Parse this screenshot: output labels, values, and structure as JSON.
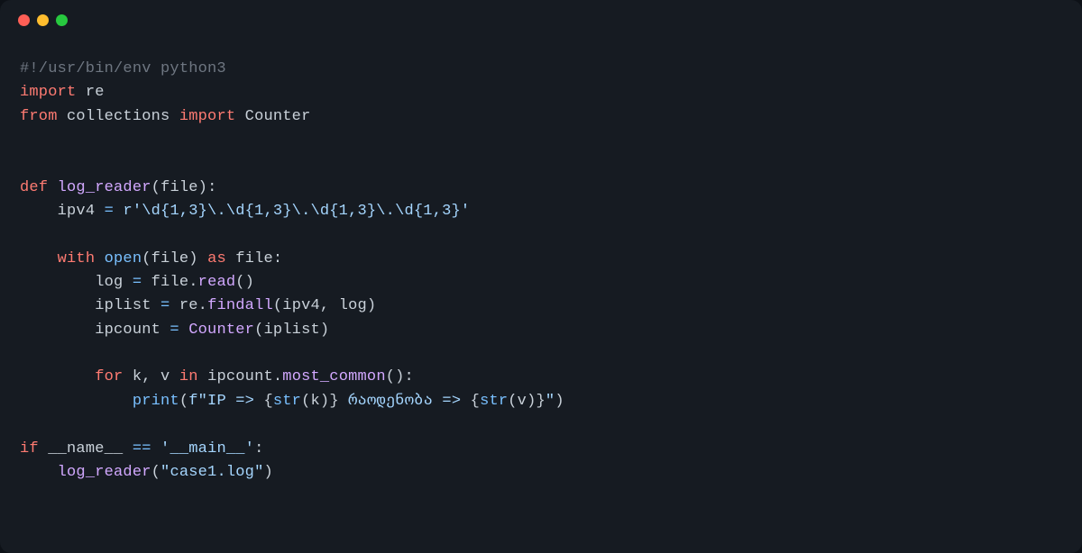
{
  "titlebar": {
    "buttons": [
      "close",
      "minimize",
      "zoom"
    ]
  },
  "code": {
    "l1_shebang": "#!/usr/bin/env python3",
    "l2_import": "import",
    "l2_re": "re",
    "l3_from": "from",
    "l3_collections": "collections",
    "l3_import": "import",
    "l3_counter": "Counter",
    "l5_def": "def",
    "l5_fname": "log_reader",
    "l5_paren_open": "(",
    "l5_param": "file",
    "l5_paren_close_colon": "):",
    "l6_indent": "    ",
    "l6_var": "ipv4",
    "l6_eq": " = ",
    "l6_str": "r'\\d{1,3}\\.\\d{1,3}\\.\\d{1,3}\\.\\d{1,3}'",
    "l8_indent": "    ",
    "l8_with": "with",
    "l8_open": "open",
    "l8_open_paren": "(",
    "l8_file1": "file",
    "l8_close_paren": ")",
    "l8_as": "as",
    "l8_file2": "file",
    "l8_colon": ":",
    "l9_indent": "        ",
    "l9_log": "log",
    "l9_eq": " = ",
    "l9_file": "file",
    "l9_dot": ".",
    "l9_read": "read",
    "l9_parens": "()",
    "l10_indent": "        ",
    "l10_iplist": "iplist",
    "l10_eq": " = ",
    "l10_re": "re",
    "l10_dot": ".",
    "l10_findall": "findall",
    "l10_args": "(ipv4, log)",
    "l11_indent": "        ",
    "l11_ipcount": "ipcount",
    "l11_eq": " = ",
    "l11_counter": "Counter",
    "l11_args": "(iplist)",
    "l13_indent": "        ",
    "l13_for": "for",
    "l13_kv": " k, v ",
    "l13_in": "in",
    "l13_ipcount": " ipcount",
    "l13_dot": ".",
    "l13_mc": "most_common",
    "l13_parens": "():",
    "l14_indent": "            ",
    "l14_print": "print",
    "l14_open": "(",
    "l14_f": "f\"IP => ",
    "l14_b1o": "{",
    "l14_str1": "str",
    "l14_k": "(k)",
    "l14_b1c": "}",
    "l14_mid": " რაოდენობა => ",
    "l14_b2o": "{",
    "l14_str2": "str",
    "l14_v": "(v)",
    "l14_b2c": "}",
    "l14_end": "\"",
    "l14_close": ")",
    "l16_if": "if",
    "l16_name": " __name__ ",
    "l16_eqeq": "==",
    "l16_main": " '__main__'",
    "l16_colon": ":",
    "l17_indent": "    ",
    "l17_fn": "log_reader",
    "l17_args_open": "(",
    "l17_argstr": "\"case1.log\"",
    "l17_args_close": ")"
  }
}
